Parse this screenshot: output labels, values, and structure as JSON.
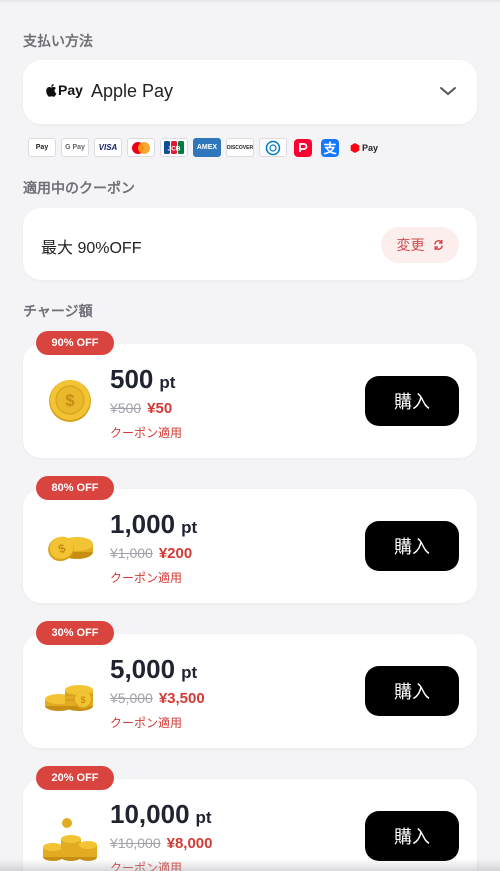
{
  "payment": {
    "section_label": "支払い方法",
    "apple_pay_logo_text": "Pay",
    "selected": "Apple Pay",
    "brands": [
      "Pay",
      "G Pay",
      "VISA",
      "mastercard",
      "JCB",
      "AMEX",
      "DISCOVER",
      "Diners Club",
      "PayPay",
      "Alipay",
      "Pay"
    ]
  },
  "coupon": {
    "section_label": "適用中のクーポン",
    "text": "最大 90%OFF",
    "change_label": "変更"
  },
  "charge": {
    "section_label": "チャージ額",
    "unit": "pt",
    "buy_label": "購入",
    "applied_label": "クーポン適用",
    "items": [
      {
        "badge": "90% OFF",
        "amount": "500",
        "old_price": "¥500",
        "new_price": "¥50"
      },
      {
        "badge": "80% OFF",
        "amount": "1,000",
        "old_price": "¥1,000",
        "new_price": "¥200"
      },
      {
        "badge": "30% OFF",
        "amount": "5,000",
        "old_price": "¥5,000",
        "new_price": "¥3,500"
      },
      {
        "badge": "20% OFF",
        "amount": "10,000",
        "old_price": "¥10,000",
        "new_price": "¥8,000"
      }
    ]
  },
  "colors": {
    "accent_red": "#d9443f",
    "buy_button": "#000000",
    "coin_gold": "#e9b82b"
  }
}
